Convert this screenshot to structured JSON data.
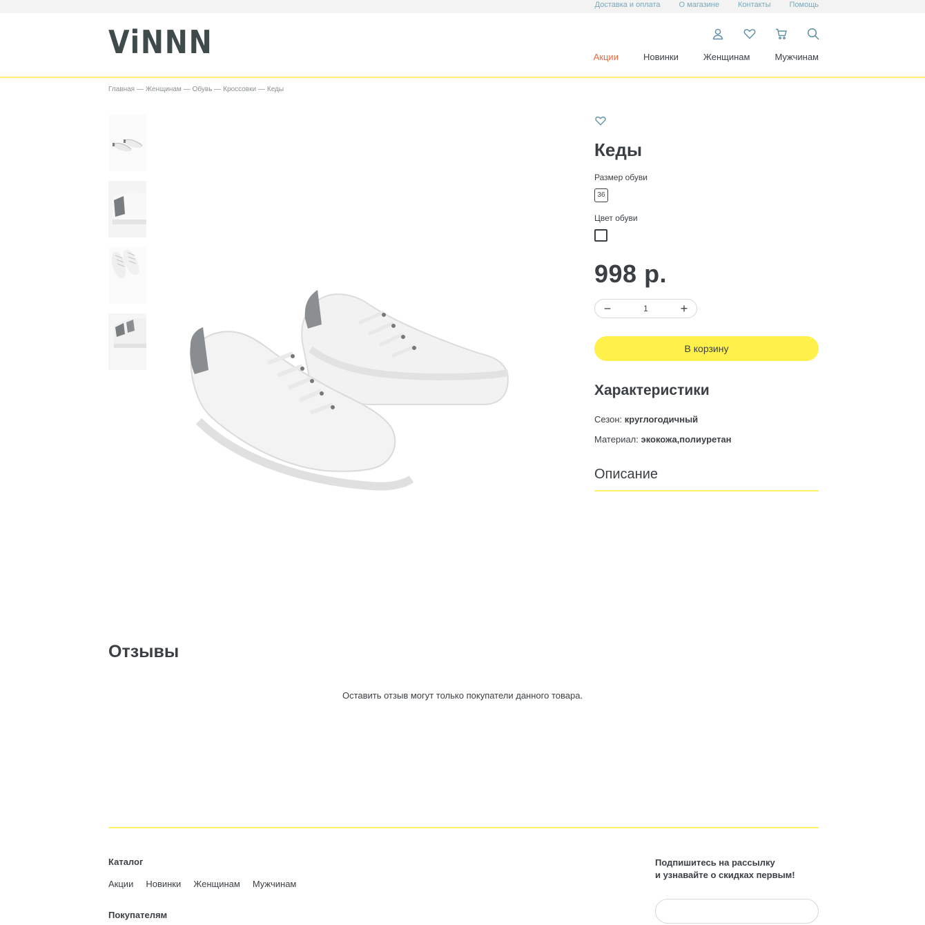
{
  "topbar": {
    "links": [
      "Доставка и оплата",
      "О магазине",
      "Контакты",
      "Помощь"
    ]
  },
  "header": {
    "logo": "ViNNN",
    "icons": [
      "user-icon",
      "heart-icon",
      "cart-icon",
      "search-icon"
    ],
    "nav": [
      "Акции",
      "Новинки",
      "Женщинам",
      "Мужчинам"
    ]
  },
  "breadcrumb": [
    "Главная —",
    "Женщинам —",
    "Обувь —",
    "Кроссовки —",
    "Кеды"
  ],
  "product": {
    "title": "Кеды",
    "size_label": "Размер обуви",
    "size_value": "36",
    "color_label": "Цвет обуви",
    "price": "998 р.",
    "quantity": "1",
    "qty_minus": "−",
    "qty_plus": "+",
    "cart_button": "В корзину",
    "specs_title": "Характеристики",
    "specs": [
      {
        "label": "Сезон:",
        "value": "круглогодичный"
      },
      {
        "label": "Материал:",
        "value": "экокожа,полиуретан"
      }
    ],
    "description_title": "Описание"
  },
  "reviews": {
    "title": "Отзывы",
    "note": "Оставить отзыв могут только покупатели данного товара."
  },
  "footer": {
    "catalog_title": "Каталог",
    "catalog_links": [
      "Акции",
      "Новинки",
      "Женщинам",
      "Мужчинам"
    ],
    "buyers_title": "Покупателям",
    "subscribe_line1": "Подпишитесь на рассылку",
    "subscribe_line2": "и узнавайте о скидках первым!"
  },
  "colors": {
    "accent_yellow": "#fff04a",
    "sale_orange": "#f0683c",
    "topbar_link": "#7aa7b8",
    "text": "#3a3f44"
  }
}
